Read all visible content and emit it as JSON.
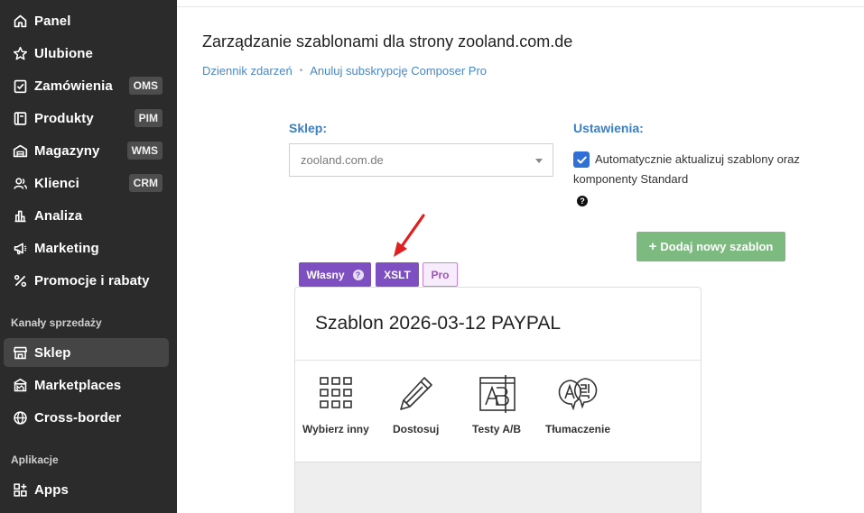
{
  "sidebar": {
    "items": [
      {
        "label": "Panel",
        "icon": "home-icon",
        "badge": ""
      },
      {
        "label": "Ulubione",
        "icon": "star-icon",
        "badge": ""
      },
      {
        "label": "Zamówienia",
        "icon": "clipboard-check-icon",
        "badge": "OMS"
      },
      {
        "label": "Produkty",
        "icon": "book-icon",
        "badge": "PIM"
      },
      {
        "label": "Magazyny",
        "icon": "warehouse-icon",
        "badge": "WMS"
      },
      {
        "label": "Klienci",
        "icon": "users-icon",
        "badge": "CRM"
      },
      {
        "label": "Analiza",
        "icon": "bar-chart-icon",
        "badge": ""
      },
      {
        "label": "Marketing",
        "icon": "megaphone-icon",
        "badge": ""
      },
      {
        "label": "Promocje i rabaty",
        "icon": "percent-icon",
        "badge": ""
      }
    ],
    "sales_channels_title": "Kanały sprzedaży",
    "sales_channels": [
      {
        "label": "Sklep",
        "icon": "store-icon",
        "active": true
      },
      {
        "label": "Marketplaces",
        "icon": "marketplace-icon",
        "active": false
      },
      {
        "label": "Cross-border",
        "icon": "globe-icon",
        "active": false
      }
    ],
    "apps_title": "Aplikacje",
    "apps": [
      {
        "label": "Apps",
        "icon": "apps-grid-icon"
      }
    ]
  },
  "header": {
    "title": "Zarządzanie szablonami dla strony zooland.com.de",
    "breadcrumbs": [
      "Dziennik zdarzeń",
      "Anuluj subskrypcję Composer Pro"
    ],
    "separator": "•"
  },
  "form": {
    "shop_label": "Sklep:",
    "shop_value": "zooland.com.de",
    "settings_label": "Ustawienia:",
    "auto_update_checked": true,
    "auto_update_text": "Automatycznie aktualizuj szablony oraz komponenty Standard",
    "help_glyph": "?"
  },
  "add_button": {
    "label": "Dodaj nowy szablon",
    "plus": "+"
  },
  "tabs": [
    {
      "label": "Własny",
      "help": "?"
    },
    {
      "label": "XSLT"
    },
    {
      "label": "Pro"
    }
  ],
  "card": {
    "title": "Szablon 2026-03-12 PAYPAL",
    "actions": [
      {
        "label": "Wybierz inny",
        "icon": "grid-icon"
      },
      {
        "label": "Dostosuj",
        "icon": "pencil-icon"
      },
      {
        "label": "Testy A/B",
        "icon": "ab-test-icon"
      },
      {
        "label": "Tłumaczenie",
        "icon": "translate-icon"
      }
    ]
  },
  "colors": {
    "sidebar_bg": "#2b2b2b",
    "accent_blue": "#3b7fc4",
    "link_blue": "#4a87c5",
    "tab_purple": "#7d4fc1",
    "add_button_green": "#7dba7f",
    "annotation_arrow": "#e02020"
  }
}
